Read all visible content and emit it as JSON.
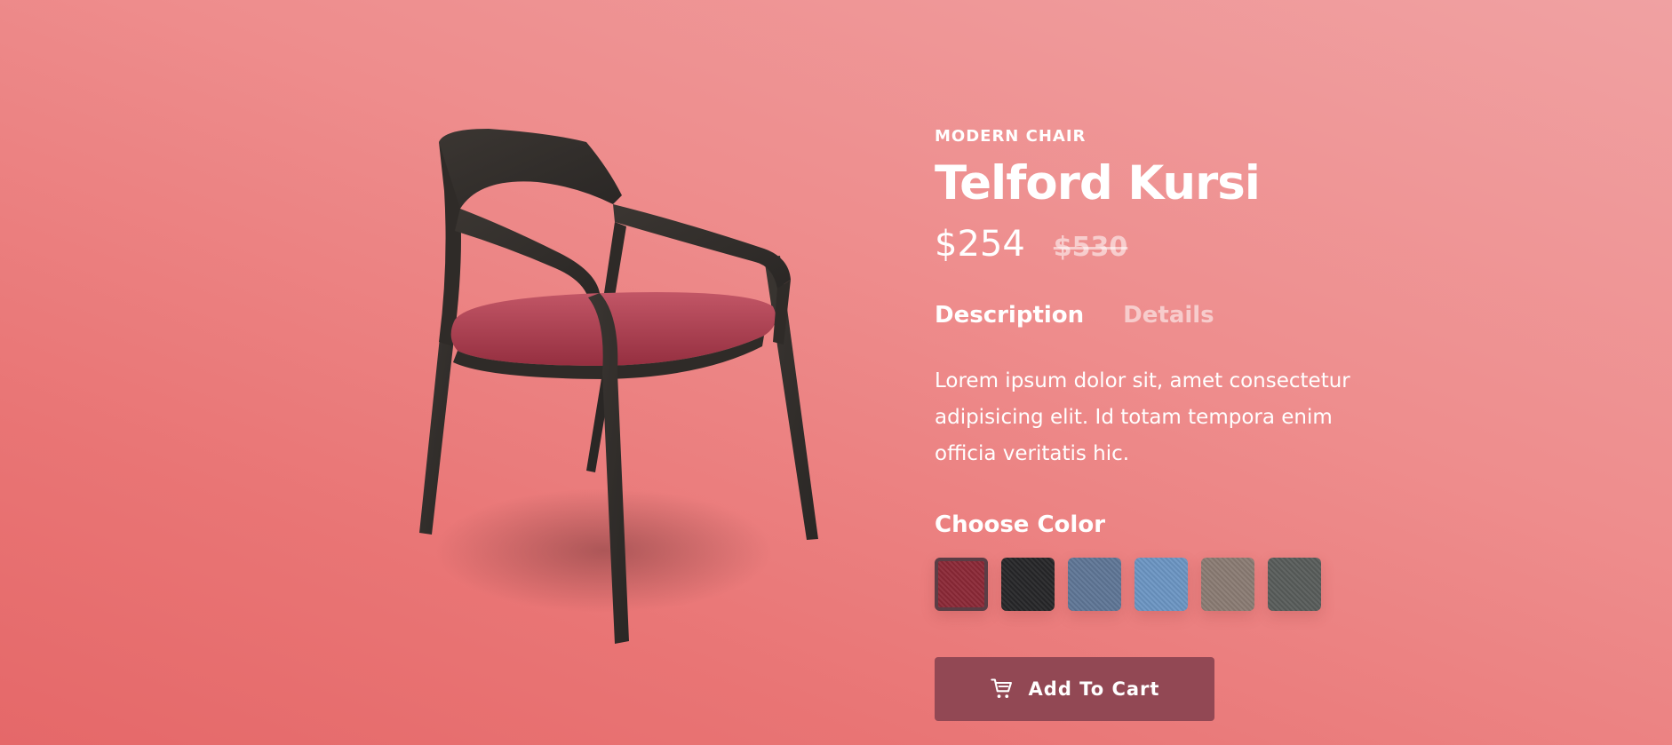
{
  "product": {
    "category": "MODERN CHAIR",
    "name": "Telford Kursi",
    "price_current": "$254",
    "price_old": "$530"
  },
  "tabs": [
    {
      "label": "Description",
      "active": true
    },
    {
      "label": "Details",
      "active": false
    }
  ],
  "description": "Lorem ipsum dolor sit, amet consectetur adipisicing elit. Id totam tempora enim officia veritatis hic.",
  "color_picker": {
    "label": "Choose Color",
    "swatches": [
      {
        "name": "burgundy",
        "color": "#8b2836",
        "selected": true
      },
      {
        "name": "charcoal",
        "color": "#262628",
        "selected": false
      },
      {
        "name": "slate-blue",
        "color": "#5f7696",
        "selected": false
      },
      {
        "name": "sky-blue",
        "color": "#6b95c2",
        "selected": false
      },
      {
        "name": "taupe",
        "color": "#8a7b73",
        "selected": false
      },
      {
        "name": "dark-gray",
        "color": "#585c5a",
        "selected": false
      }
    ]
  },
  "cart_button": {
    "label": "Add To Cart",
    "icon": "shopping-cart-icon"
  },
  "colors": {
    "background_top": "#f0a1a2",
    "background_bottom": "#e56869",
    "button": "#924854",
    "chair_wood": "#332f2c",
    "chair_seat": "#b24757"
  }
}
